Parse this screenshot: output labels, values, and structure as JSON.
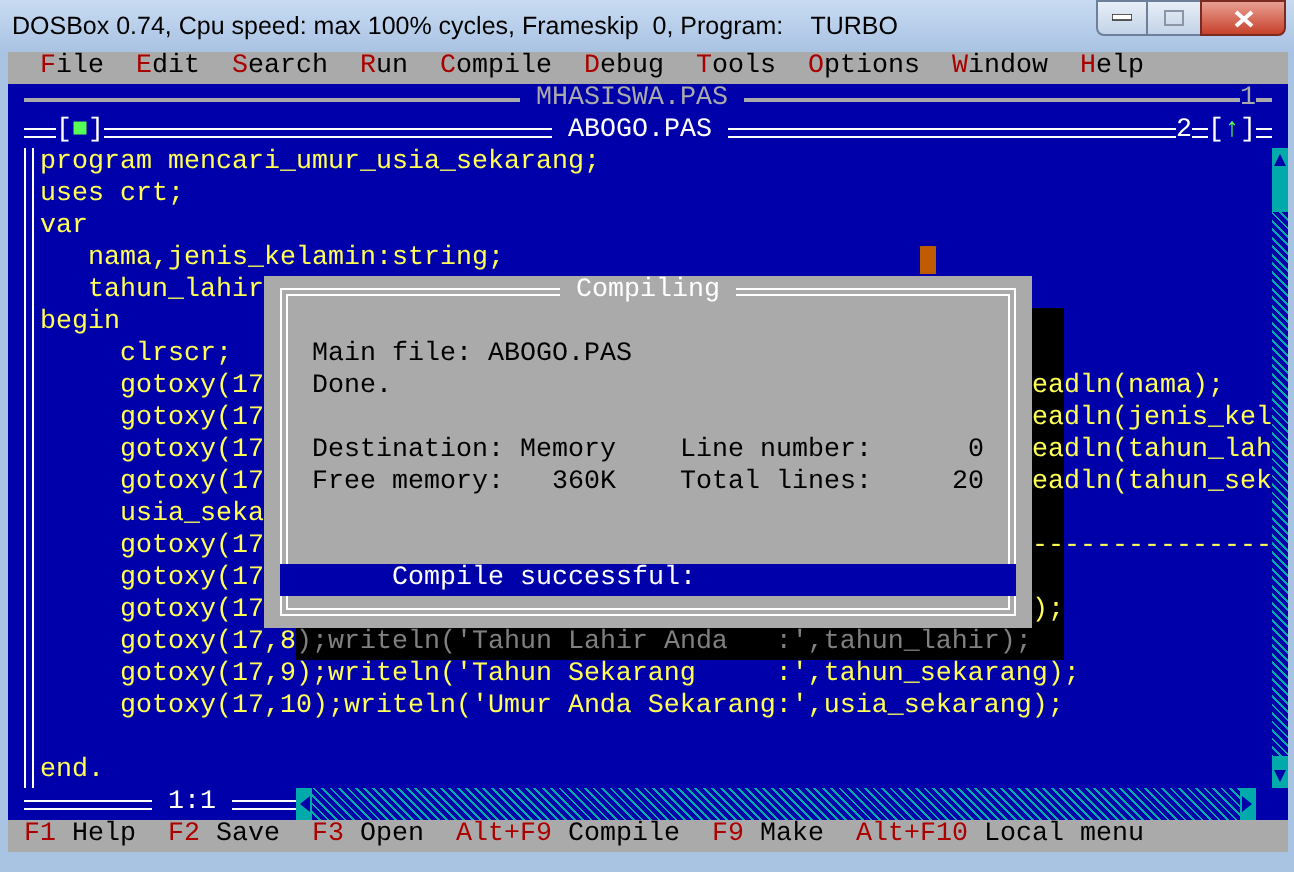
{
  "window": {
    "title": "DOSBox 0.74, Cpu speed: max 100% cycles, Frameskip  0, Program:    TURBO"
  },
  "menu": [
    {
      "label": "File"
    },
    {
      "label": "Edit"
    },
    {
      "label": "Search"
    },
    {
      "label": "Run"
    },
    {
      "label": "Compile"
    },
    {
      "label": "Debug"
    },
    {
      "label": "Tools"
    },
    {
      "label": "Options"
    },
    {
      "label": "Window"
    },
    {
      "label": "Help"
    }
  ],
  "background_window": {
    "title": "MHASISWA.PAS",
    "number": "1"
  },
  "editor": {
    "title": "ABOGO.PAS",
    "number": "2",
    "close_button": "[■]",
    "zoom_button": "[↑]",
    "cursor_position": "1:1",
    "lines": [
      {
        "text": "program mencari_umur_usia_sekarang;"
      },
      {
        "text": "uses crt;"
      },
      {
        "text": "var"
      },
      {
        "text": "   nama,jenis_kelamin:string;"
      },
      {
        "text": "   tahun_lahir"
      },
      {
        "text": "begin"
      },
      {
        "text": "     clrscr;"
      },
      {
        "text": "     gotoxy(17",
        "right": "eadln(nama);"
      },
      {
        "text": "     gotoxy(17",
        "right": "eadln(jenis_kel"
      },
      {
        "text": "     gotoxy(17",
        "right": "eadln(tahun_lah"
      },
      {
        "text": "     gotoxy(17",
        "right": "eadln(tahun_sek"
      },
      {
        "text": "     usia_seka"
      },
      {
        "text": "     gotoxy(17",
        "right": "---------------"
      },
      {
        "text": "     gotoxy(17"
      },
      {
        "text": "     gotoxy(17",
        "right": ");"
      },
      {
        "text": "     gotoxy(17,8",
        "shadowed": ");writeln('Tahun Lahir Anda   :',tahun_lahir);"
      },
      {
        "text": "     gotoxy(17,9);writeln('Tahun Sekarang     :',tahun_sekarang);"
      },
      {
        "text": "     gotoxy(17,10);writeln('Umur Anda Sekarang:',usia_sekarang);"
      },
      {
        "blank": true
      },
      {
        "text": "end."
      }
    ]
  },
  "dialog": {
    "title": "Compiling",
    "main_file": "Main file: ABOGO.PAS",
    "status": "Done.",
    "stats": [
      {
        "label": "Destination:",
        "value": "Memory"
      },
      {
        "label": "Line number:",
        "value": "0"
      },
      {
        "label": "Free memory:",
        "value": "360K"
      },
      {
        "label": "Total lines:",
        "value": "20"
      }
    ],
    "message": "Compile successful:"
  },
  "status_bar": [
    {
      "key": "F1",
      "label": "Help"
    },
    {
      "key": "F2",
      "label": "Save"
    },
    {
      "key": "F3",
      "label": "Open"
    },
    {
      "key": "Alt+F9",
      "label": "Compile"
    },
    {
      "key": "F9",
      "label": "Make"
    },
    {
      "key": "Alt+F10",
      "label": "Local menu"
    }
  ]
}
